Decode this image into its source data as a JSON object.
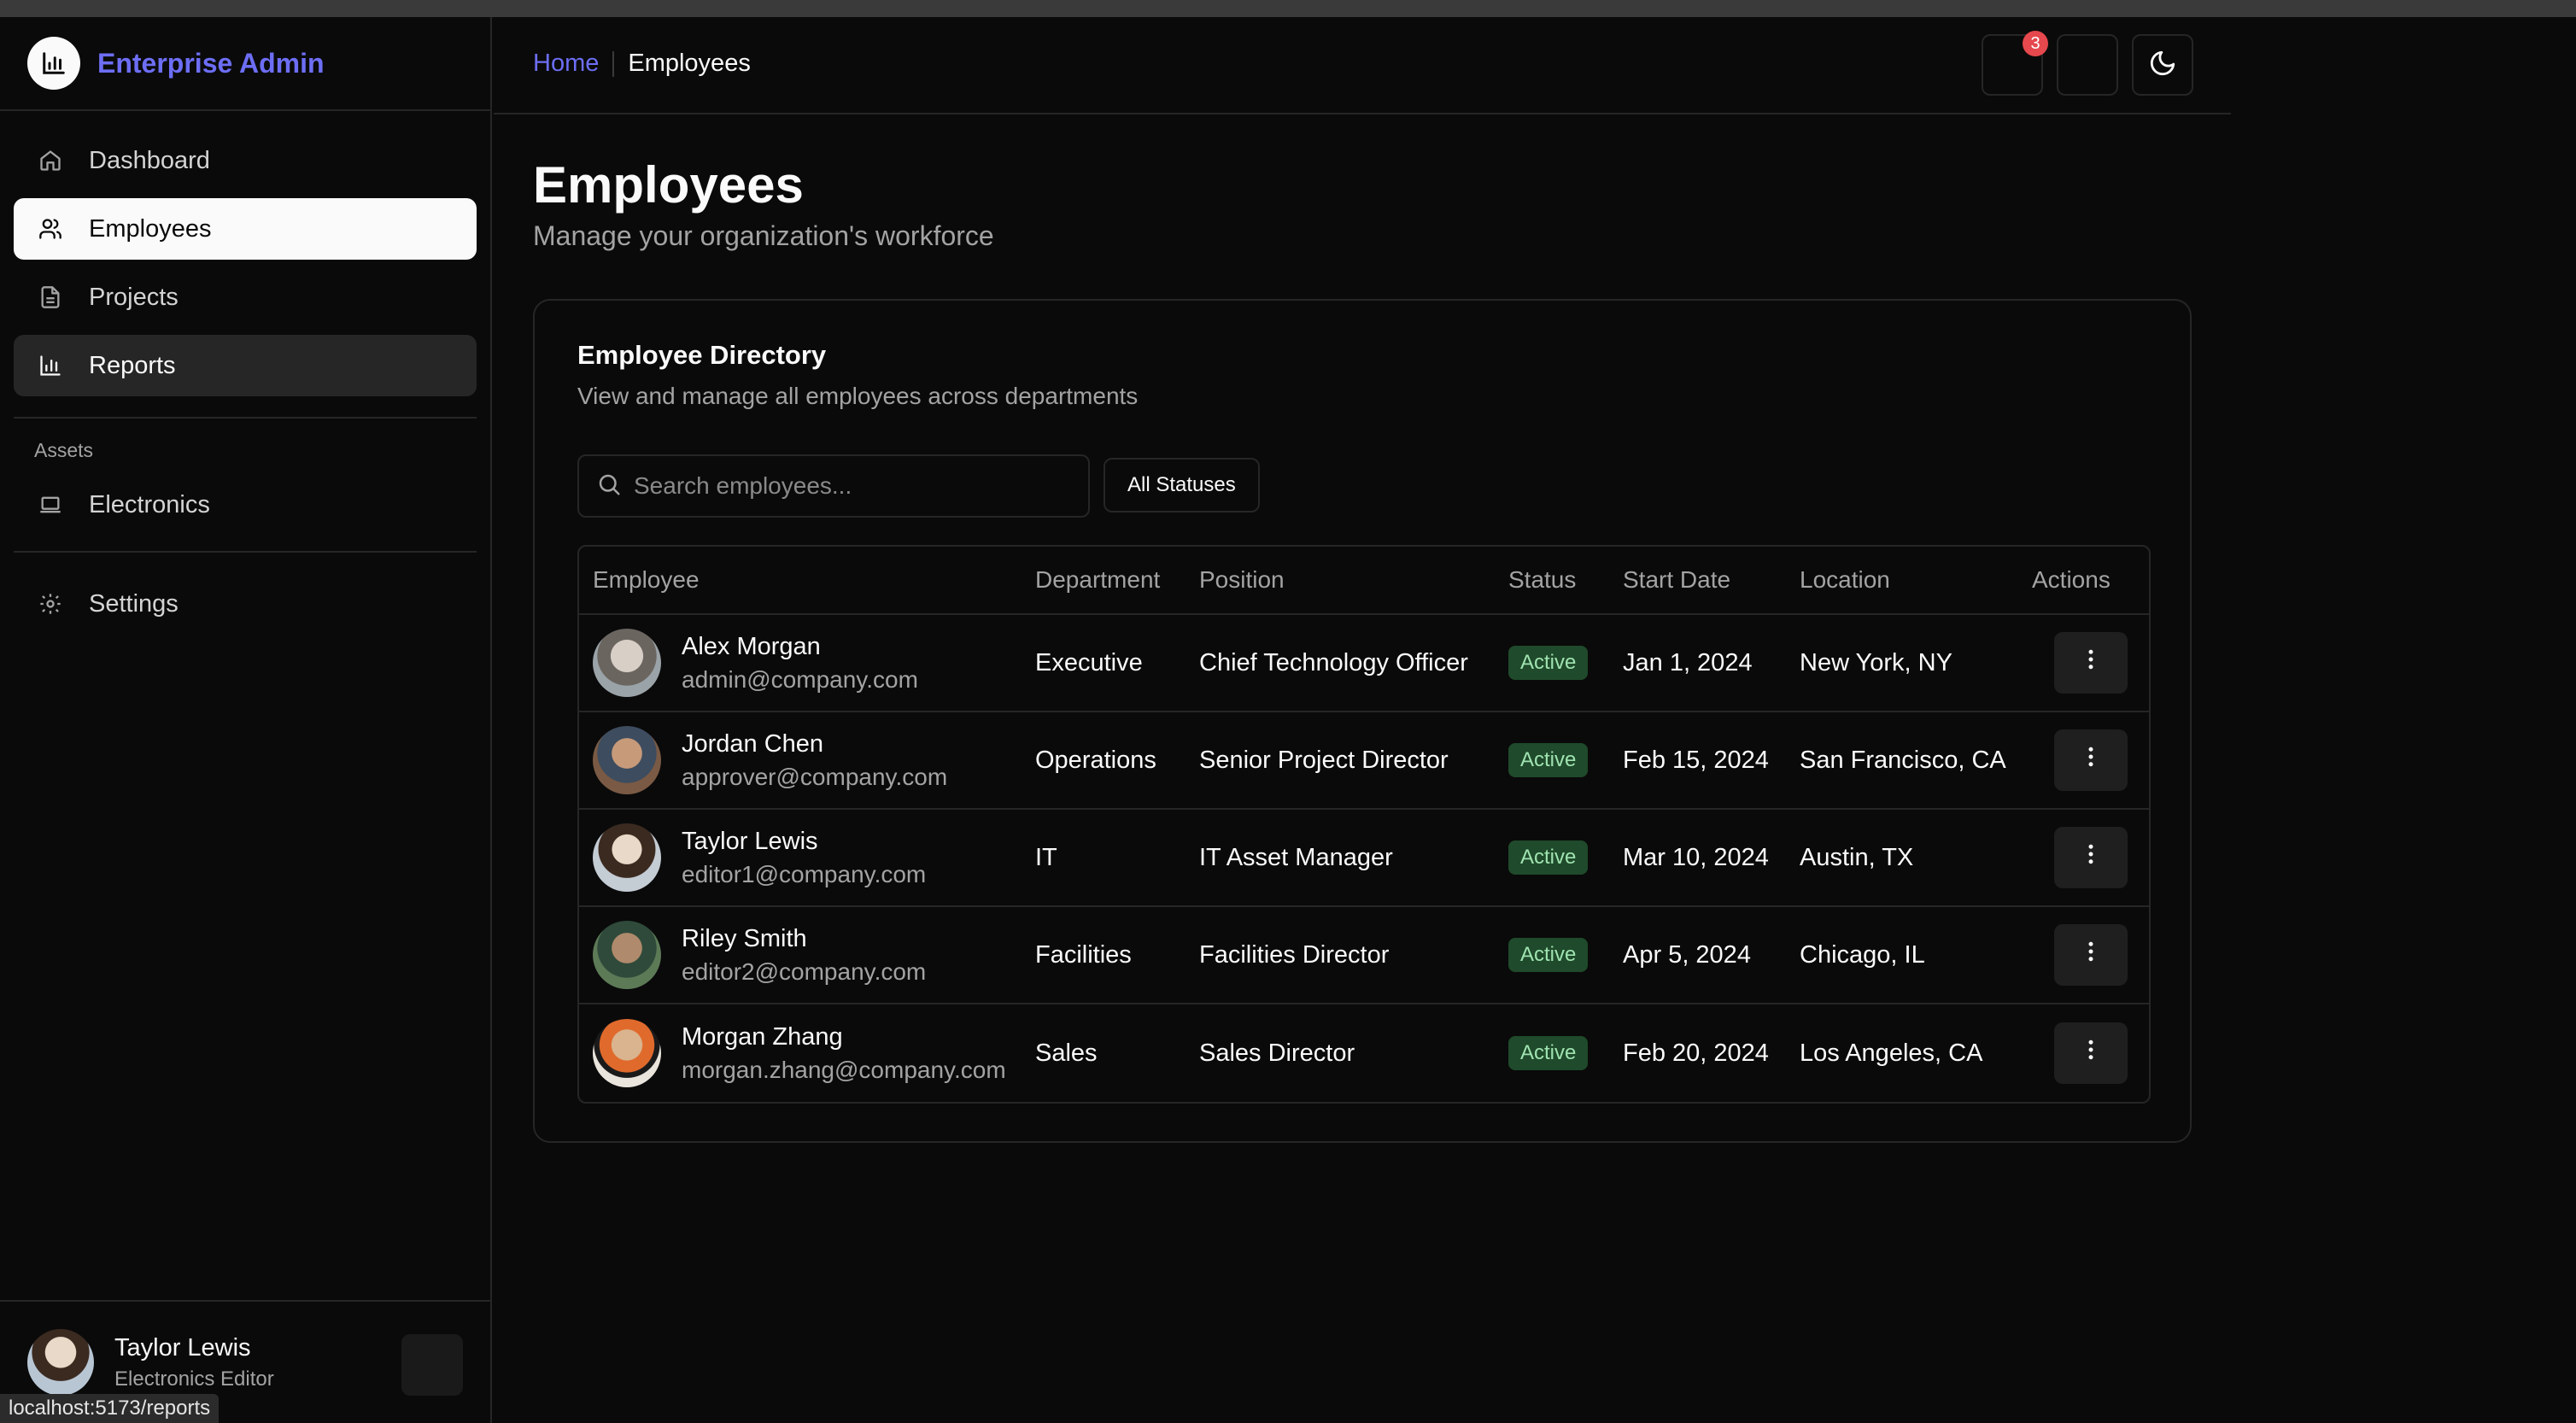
{
  "app": {
    "title": "Enterprise Admin"
  },
  "sidebar": {
    "items": [
      {
        "label": "Dashboard",
        "icon": "home-icon"
      },
      {
        "label": "Employees",
        "icon": "users-icon"
      },
      {
        "label": "Projects",
        "icon": "file-icon"
      },
      {
        "label": "Reports",
        "icon": "bar-chart-icon"
      }
    ],
    "assets_label": "Assets",
    "assets_items": [
      {
        "label": "Electronics",
        "icon": "laptop-icon"
      }
    ],
    "settings": {
      "label": "Settings",
      "icon": "gear-icon"
    }
  },
  "user": {
    "name": "Taylor Lewis",
    "role": "Electronics Editor"
  },
  "status_url": "localhost:5173/reports",
  "header": {
    "breadcrumb": {
      "home": "Home",
      "current": "Employees"
    },
    "notification_count": "3"
  },
  "page": {
    "title": "Employees",
    "subtitle": "Manage your organization's workforce"
  },
  "directory": {
    "title": "Employee Directory",
    "subtitle": "View and manage all employees across departments",
    "search_placeholder": "Search employees...",
    "filter_label": "All Statuses",
    "columns": [
      "Employee",
      "Department",
      "Position",
      "Status",
      "Start Date",
      "Location",
      "Actions"
    ],
    "rows": [
      {
        "name": "Alex Morgan",
        "email": "admin@company.com",
        "department": "Executive",
        "position": "Chief Technology Officer",
        "status": "Active",
        "start_date": "Jan 1, 2024",
        "location": "New York, NY"
      },
      {
        "name": "Jordan Chen",
        "email": "approver@company.com",
        "department": "Operations",
        "position": "Senior Project Director",
        "status": "Active",
        "start_date": "Feb 15, 2024",
        "location": "San Francisco, CA"
      },
      {
        "name": "Taylor Lewis",
        "email": "editor1@company.com",
        "department": "IT",
        "position": "IT Asset Manager",
        "status": "Active",
        "start_date": "Mar 10, 2024",
        "location": "Austin, TX"
      },
      {
        "name": "Riley Smith",
        "email": "editor2@company.com",
        "department": "Facilities",
        "position": "Facilities Director",
        "status": "Active",
        "start_date": "Apr 5, 2024",
        "location": "Chicago, IL"
      },
      {
        "name": "Morgan Zhang",
        "email": "morgan.zhang@company.com",
        "department": "Sales",
        "position": "Sales Director",
        "status": "Active",
        "start_date": "Feb 20, 2024",
        "location": "Los Angeles, CA"
      }
    ]
  },
  "colors": {
    "brand": "#6d6ef5",
    "status_active_bg": "#1f4a2b",
    "status_active_text": "#9fe3b0",
    "badge": "#e5484d"
  }
}
